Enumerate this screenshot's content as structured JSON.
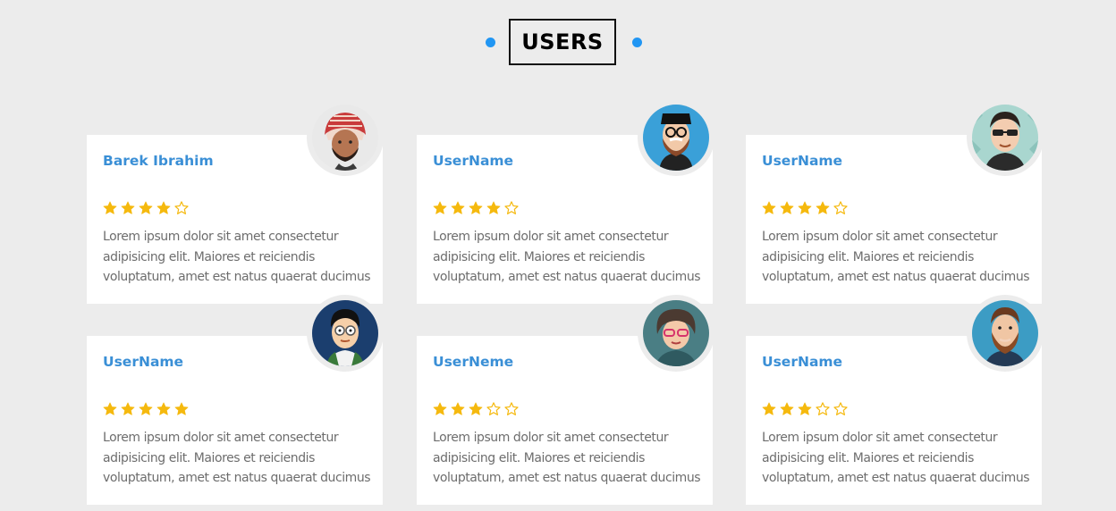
{
  "section": {
    "title": "USERS",
    "accent_color": "#2196f3"
  },
  "star_color": "#f5b90e",
  "users": [
    {
      "name": "Barek Ibrahim",
      "rating": 4,
      "description": "Lorem ipsum dolor sit amet consectetur adipisicing elit. Maiores et reiciendis voluptatum, amet est natus quaerat ducimus"
    },
    {
      "name": "UserName",
      "rating": 4,
      "description": "Lorem ipsum dolor sit amet consectetur adipisicing elit. Maiores et reiciendis voluptatum, amet est natus quaerat ducimus"
    },
    {
      "name": "UserName",
      "rating": 4,
      "description": "Lorem ipsum dolor sit amet consectetur adipisicing elit. Maiores et reiciendis voluptatum, amet est natus quaerat ducimus"
    },
    {
      "name": "UserName",
      "rating": 5,
      "description": "Lorem ipsum dolor sit amet consectetur adipisicing elit. Maiores et reiciendis voluptatum, amet est natus quaerat ducimus"
    },
    {
      "name": "UserNeme",
      "rating": 3,
      "description": "Lorem ipsum dolor sit amet consectetur adipisicing elit. Maiores et reiciendis voluptatum, amet est natus quaerat ducimus"
    },
    {
      "name": "UserName",
      "rating": 3,
      "description": "Lorem ipsum dolor sit amet consectetur adipisicing elit. Maiores et reiciendis voluptatum, amet est natus quaerat ducimus"
    }
  ]
}
